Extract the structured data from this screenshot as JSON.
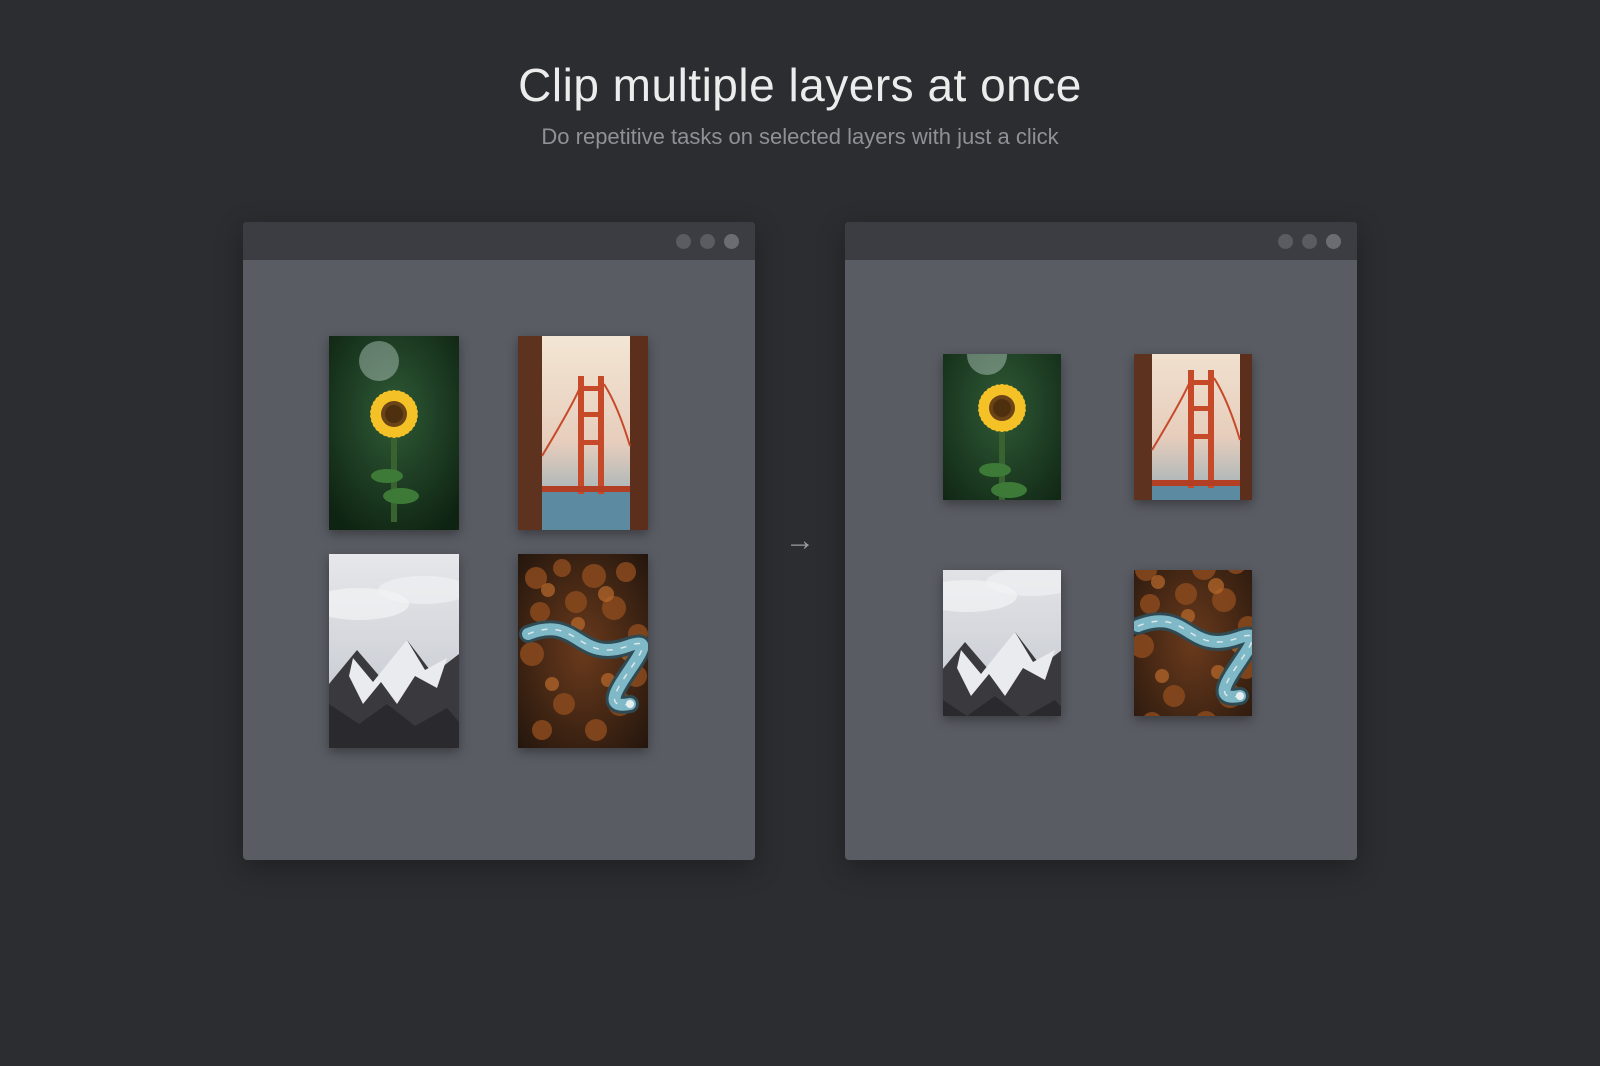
{
  "heading": "Clip multiple layers at once",
  "subheading": "Do repetitive tasks on selected layers with just a click",
  "arrow_glyph": "→",
  "thumbnails": {
    "t1": "sunflower-photo",
    "t2": "golden-gate-photo",
    "t3": "snow-mountain-photo",
    "t4": "winding-road-photo"
  }
}
